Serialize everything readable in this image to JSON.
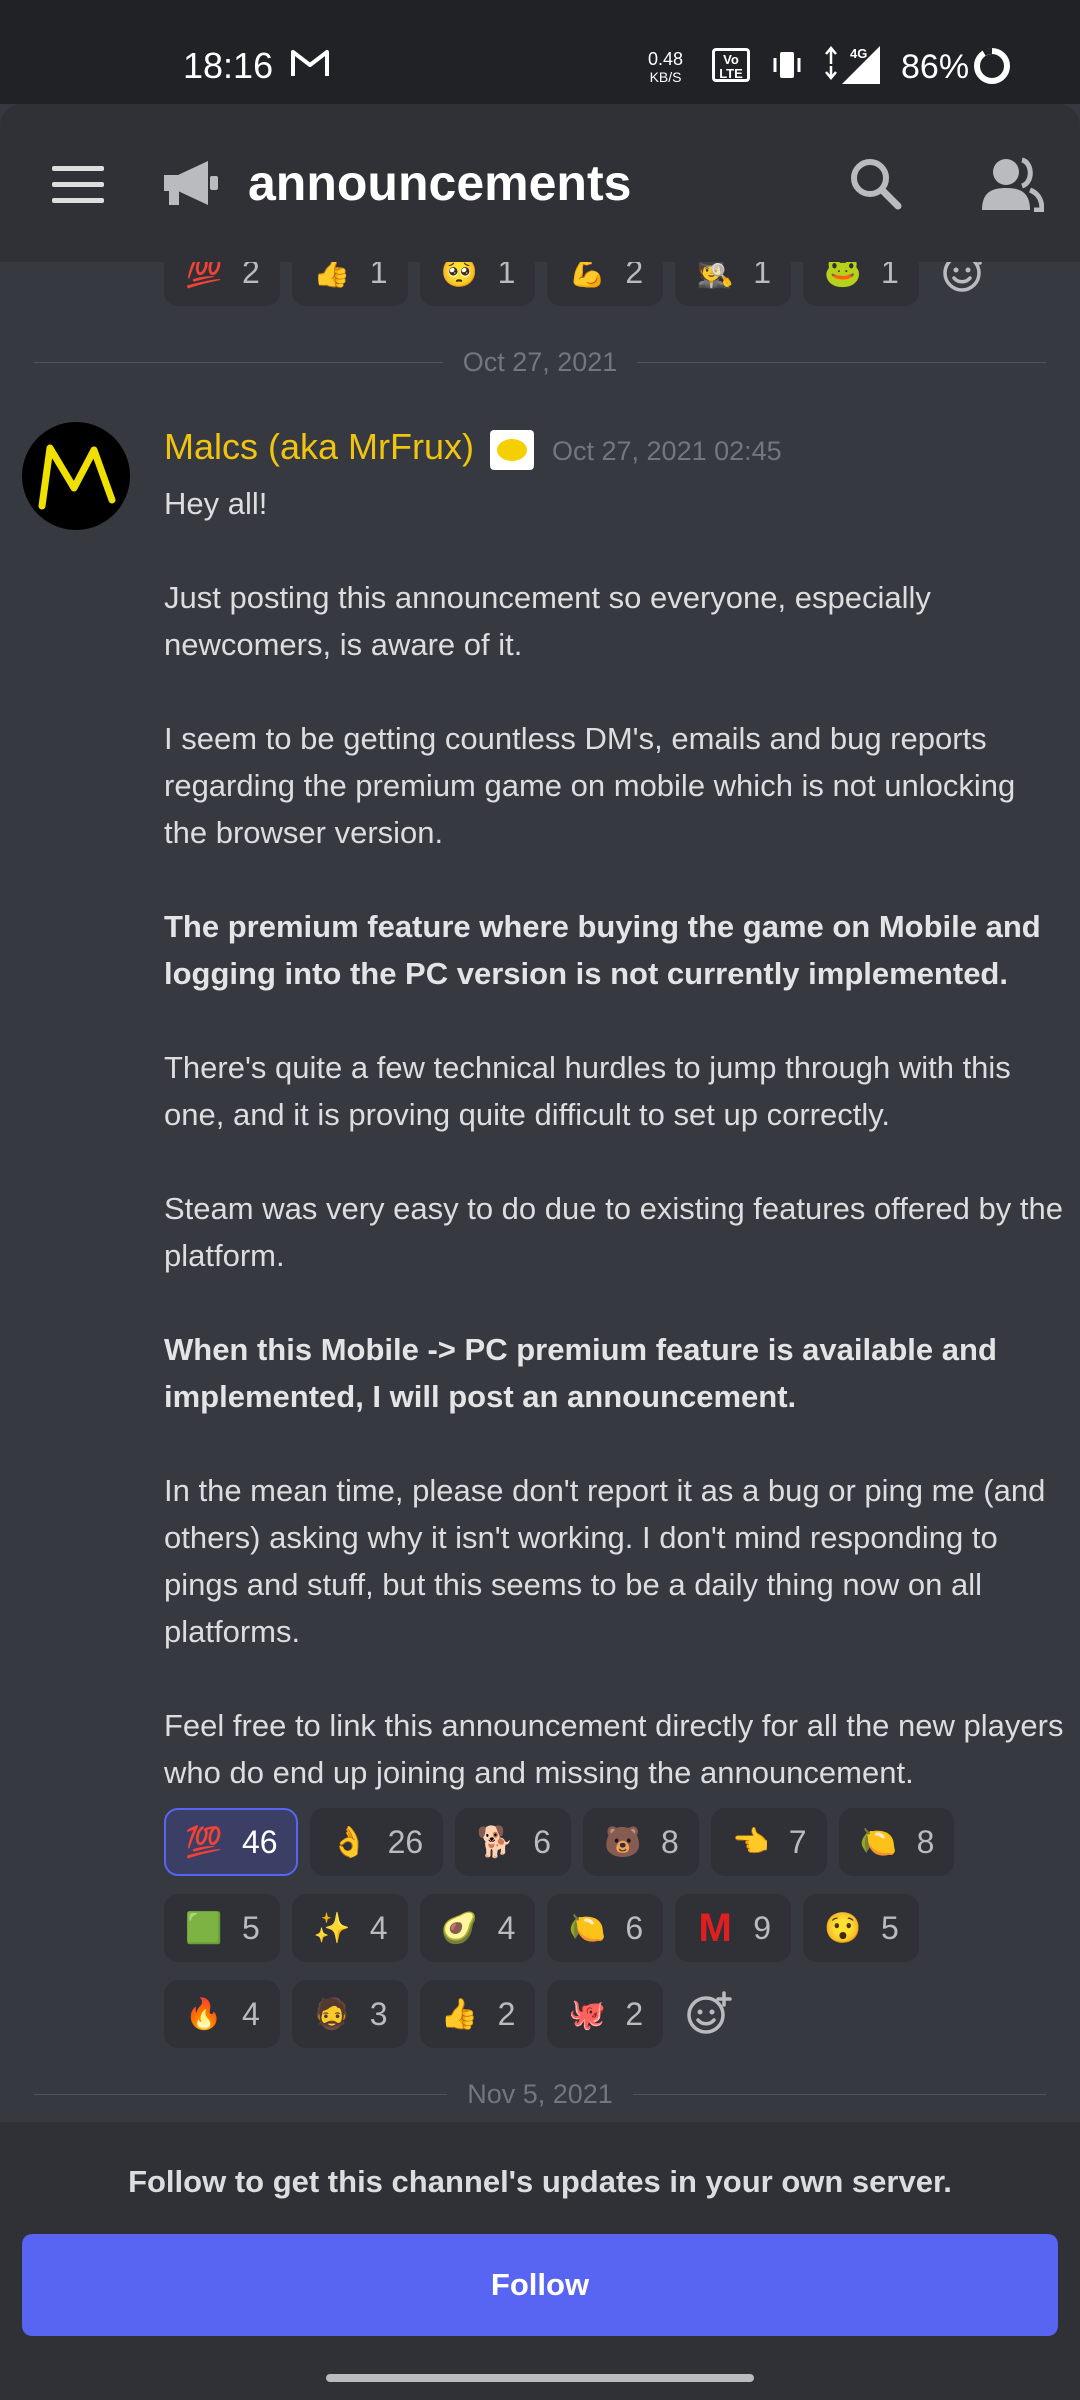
{
  "status_bar": {
    "time": "18:16",
    "net_speed_value": "0.48",
    "net_speed_unit": "KB/S",
    "volte": "Vo LTE",
    "network": "4G",
    "battery": "86%"
  },
  "header": {
    "channel_name": "announcements"
  },
  "top_reactions": [
    {
      "emoji": "💯",
      "count": "2"
    },
    {
      "emoji": "👍",
      "count": "1"
    },
    {
      "emoji": "🥺",
      "count": "1"
    },
    {
      "emoji": "💪",
      "count": "2"
    },
    {
      "emoji": "🕵️",
      "count": "1"
    },
    {
      "emoji": "🐸",
      "count": "1"
    }
  ],
  "date_divider_1": "Oct 27, 2021",
  "message": {
    "author": "Malcs (aka MrFrux)",
    "timestamp": "Oct 27, 2021 02:45",
    "paragraphs": [
      {
        "text": "Hey all!",
        "bold": false
      },
      {
        "text": "Just posting this announcement so everyone, especially newcomers, is aware of it.",
        "bold": false
      },
      {
        "text": "I seem to be getting countless DM's, emails and bug reports regarding the premium game on mobile which is not unlocking the browser version.",
        "bold": false
      },
      {
        "text": "The premium feature where buying the game on Mobile and logging into the PC version is not currently implemented.",
        "bold": true
      },
      {
        "text": "There's quite a few technical hurdles to jump through with this one, and it is proving quite difficult to set up correctly.",
        "bold": false
      },
      {
        "text": "Steam was very easy to do due to existing features offered by the platform.",
        "bold": false
      },
      {
        "text": "When this Mobile -> PC premium feature is available and implemented, I will post an announcement.",
        "bold": true
      },
      {
        "text": "In the mean time, please don't report it as a bug or ping me (and others) asking why it isn't working. I don't mind responding to pings and stuff, but this seems to be a daily thing now on all platforms.",
        "bold": false
      },
      {
        "text": "Feel free to link this announcement directly for all the new players who do end up joining and missing the announcement.",
        "bold": false
      }
    ]
  },
  "message_reactions": {
    "row1": [
      {
        "emoji": "💯",
        "count": "46",
        "active": true
      },
      {
        "emoji": "👌",
        "count": "26"
      },
      {
        "emoji": "🐕",
        "count": "6"
      },
      {
        "emoji": "🐻",
        "count": "8"
      },
      {
        "emoji": "👈",
        "count": "7"
      },
      {
        "emoji": "🍋",
        "count": "8"
      }
    ],
    "row2": [
      {
        "emoji": "🟩",
        "count": "5"
      },
      {
        "emoji": "✨",
        "count": "4"
      },
      {
        "emoji": "🥑",
        "count": "4"
      },
      {
        "emoji": "🍋",
        "count": "6"
      },
      {
        "emoji": "M",
        "count": "9"
      },
      {
        "emoji": "😯",
        "count": "5"
      }
    ],
    "row3": [
      {
        "emoji": "🔥",
        "count": "4"
      },
      {
        "emoji": "🧔",
        "count": "3"
      },
      {
        "emoji": "👍",
        "count": "2"
      },
      {
        "emoji": "🐙",
        "count": "2"
      }
    ]
  },
  "date_divider_2": "Nov 5, 2021",
  "footer": {
    "note": "Follow to get this channel's updates in your own server.",
    "follow_label": "Follow"
  }
}
